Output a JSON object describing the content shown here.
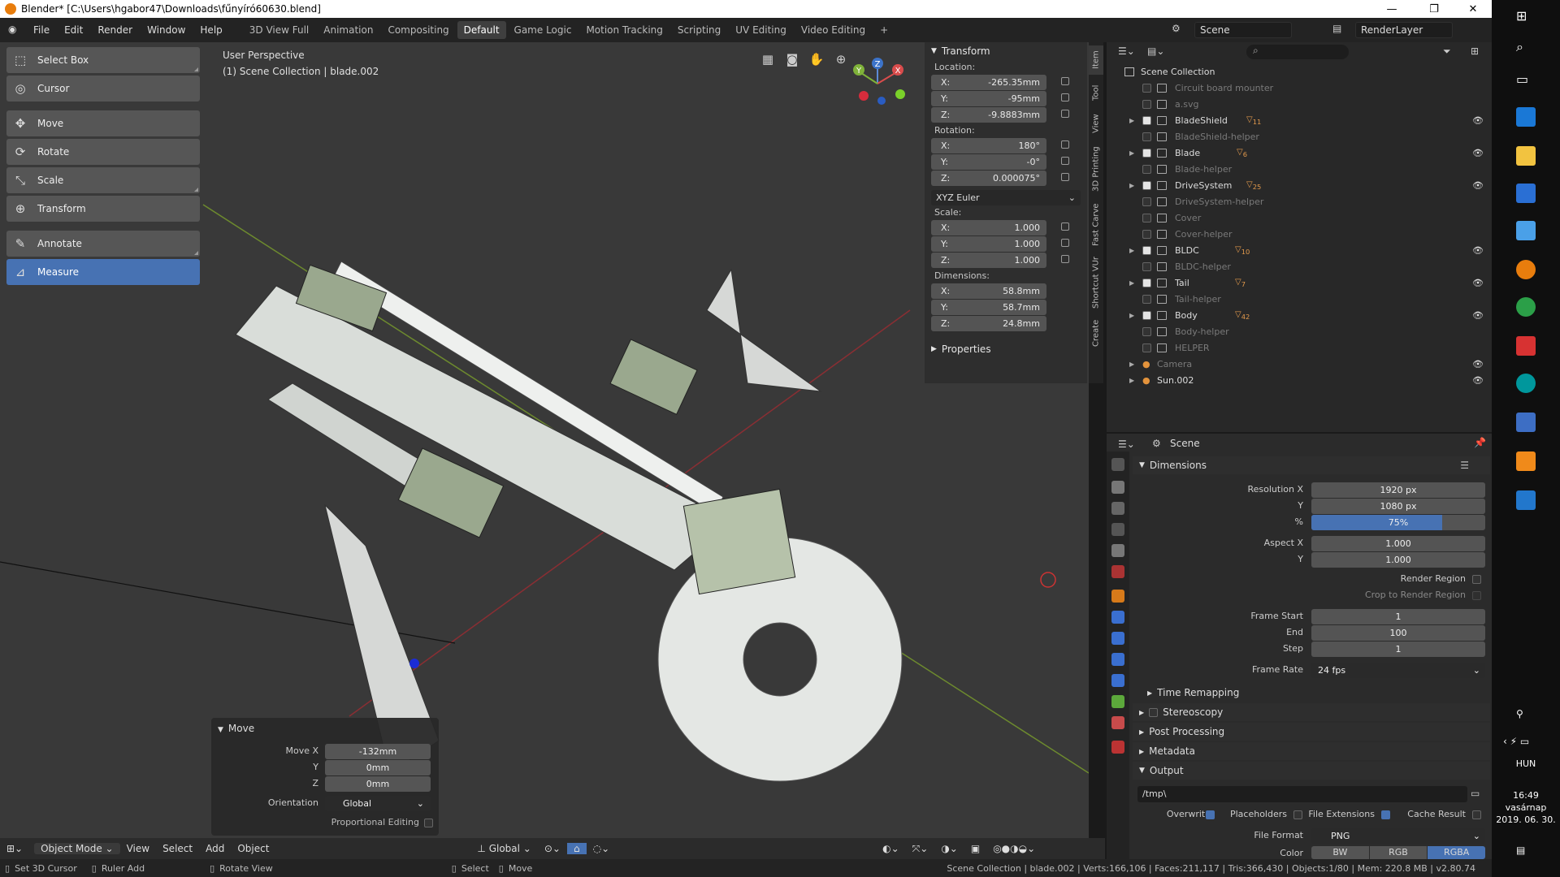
{
  "titlebar": {
    "title": "Blender* [C:\\Users\\hgabor47\\Downloads\\fűnyíró60630.blend]"
  },
  "menu": [
    "File",
    "Edit",
    "Render",
    "Window",
    "Help"
  ],
  "workspaces": [
    "3D View Full",
    "Animation",
    "Compositing",
    "Default",
    "Game Logic",
    "Motion Tracking",
    "Scripting",
    "UV Editing",
    "Video Editing"
  ],
  "active_workspace": "Default",
  "scene_name": "Scene",
  "render_layer": "RenderLayer",
  "tools": [
    {
      "label": "Select Box",
      "icon": "select-box-icon"
    },
    {
      "label": "Cursor",
      "icon": "cursor-icon"
    },
    {
      "label": "Move",
      "icon": "move-icon"
    },
    {
      "label": "Rotate",
      "icon": "rotate-icon"
    },
    {
      "label": "Scale",
      "icon": "scale-icon"
    },
    {
      "label": "Transform",
      "icon": "transform-icon"
    },
    {
      "label": "Annotate",
      "icon": "annotate-icon"
    },
    {
      "label": "Measure",
      "icon": "measure-icon"
    }
  ],
  "viewport": {
    "perspective": "User Perspective",
    "context": "(1) Scene Collection | blade.002"
  },
  "gizmo": {
    "x": "X",
    "y": "Y",
    "z": "Z"
  },
  "transform": {
    "header": "Transform",
    "location_label": "Location:",
    "location": {
      "x": "-265.35mm",
      "y": "-95mm",
      "z": "-9.8883mm"
    },
    "rotation_label": "Rotation:",
    "rotation": {
      "x": "180°",
      "y": "-0°",
      "z": "0.000075°"
    },
    "rotation_mode": "XYZ Euler",
    "scale_label": "Scale:",
    "scale": {
      "x": "1.000",
      "y": "1.000",
      "z": "1.000"
    },
    "dimensions_label": "Dimensions:",
    "dimensions": {
      "x": "58.8mm",
      "y": "58.7mm",
      "z": "24.8mm"
    },
    "axis": {
      "x": "X:",
      "y": "Y:",
      "z": "Z:"
    },
    "properties_header": "Properties"
  },
  "ntabs": [
    "Item",
    "Tool",
    "View",
    "3D Printing",
    "Fast Carve",
    "Shortcut VUr",
    "Create"
  ],
  "redo_panel": {
    "header": "Move",
    "move_x_label": "Move X",
    "move_x": "-132mm",
    "y_label": "Y",
    "y": "0mm",
    "z_label": "Z",
    "z": "0mm",
    "orientation_label": "Orientation",
    "orientation": "Global",
    "proportional_label": "Proportional Editing"
  },
  "viewport_header": {
    "mode": "Object Mode",
    "items": [
      "View",
      "Select",
      "Add",
      "Object"
    ],
    "transform_orientation": "Global"
  },
  "statusbar": {
    "left": [
      "Set 3D Cursor",
      "Ruler Add",
      "Rotate View",
      "Select",
      "Move"
    ],
    "stats": "Scene Collection | blade.002 | Verts:166,106 | Faces:211,117 | Tris:366,430 | Objects:1/80 | Mem: 220.8 MB | v2.80.74"
  },
  "outliner": {
    "root": "Scene Collection",
    "items": [
      {
        "name": "Circuit board mounter",
        "checked": false,
        "dim": true,
        "eye": false,
        "expand": false
      },
      {
        "name": "a.svg",
        "checked": false,
        "dim": true,
        "eye": false,
        "expand": false
      },
      {
        "name": "BladeShield",
        "checked": true,
        "dim": false,
        "eye": true,
        "expand": true,
        "badge": "11"
      },
      {
        "name": "BladeShield-helper",
        "checked": false,
        "dim": true,
        "eye": false,
        "expand": false
      },
      {
        "name": "Blade",
        "checked": true,
        "dim": false,
        "eye": true,
        "expand": true,
        "badge": "6"
      },
      {
        "name": "Blade-helper",
        "checked": false,
        "dim": true,
        "eye": false,
        "expand": false
      },
      {
        "name": "DriveSystem",
        "checked": true,
        "dim": false,
        "eye": true,
        "expand": true,
        "badge": "25"
      },
      {
        "name": "DriveSystem-helper",
        "checked": false,
        "dim": true,
        "eye": false,
        "expand": false
      },
      {
        "name": "Cover",
        "checked": false,
        "dim": true,
        "eye": false,
        "expand": false
      },
      {
        "name": "Cover-helper",
        "checked": false,
        "dim": true,
        "eye": false,
        "expand": false
      },
      {
        "name": "BLDC",
        "checked": true,
        "dim": false,
        "eye": true,
        "expand": true,
        "badge": "10"
      },
      {
        "name": "BLDC-helper",
        "checked": false,
        "dim": true,
        "eye": false,
        "expand": false
      },
      {
        "name": "Tail",
        "checked": true,
        "dim": false,
        "eye": true,
        "expand": true,
        "badge": "7"
      },
      {
        "name": "Tail-helper",
        "checked": false,
        "dim": true,
        "eye": false,
        "expand": false
      },
      {
        "name": "Body",
        "checked": true,
        "dim": false,
        "eye": true,
        "expand": true,
        "badge": "42"
      },
      {
        "name": "Body-helper",
        "checked": false,
        "dim": true,
        "eye": false,
        "expand": false
      },
      {
        "name": "HELPER",
        "checked": false,
        "dim": true,
        "eye": false,
        "expand": false
      }
    ],
    "objects": [
      {
        "name": "Camera",
        "dim": true
      },
      {
        "name": "Sun.002",
        "dim": false
      }
    ]
  },
  "properties": {
    "context": "Scene",
    "dimensions_header": "Dimensions",
    "resolution_x_label": "Resolution X",
    "resolution_x": "1920 px",
    "resolution_y_label": "Y",
    "resolution_y": "1080 px",
    "percent_label": "%",
    "percent": "75%",
    "percent_value": 0.75,
    "aspect_x_label": "Aspect X",
    "aspect_x": "1.000",
    "aspect_y_label": "Y",
    "aspect_y": "1.000",
    "render_region_label": "Render Region",
    "crop_label": "Crop to Render Region",
    "frame_start_label": "Frame Start",
    "frame_start": "1",
    "end_label": "End",
    "end": "100",
    "step_label": "Step",
    "step": "1",
    "frame_rate_label": "Frame Rate",
    "frame_rate": "24 fps",
    "time_remapping": "Time Remapping",
    "stereoscopy": "Stereoscopy",
    "post_processing": "Post Processing",
    "metadata": "Metadata",
    "output_header": "Output",
    "output_path": "/tmp\\",
    "overwrite_label": "Overwrite",
    "placeholders_label": "Placeholders",
    "file_ext_label": "File Extensions",
    "cache_label": "Cache Result",
    "file_format_label": "File Format",
    "file_format": "PNG",
    "color_label": "Color",
    "color_options": [
      "BW",
      "RGB",
      "RGBA"
    ],
    "color_selected": "RGBA"
  },
  "taskbar": {
    "lang": "HUN",
    "time": "16:49",
    "day": "vasárnap",
    "date": "2019. 06. 30."
  },
  "colors": {
    "accent": "#4772b3",
    "viewport_bg": "#393939",
    "panel_bg": "#2b2b2b"
  }
}
